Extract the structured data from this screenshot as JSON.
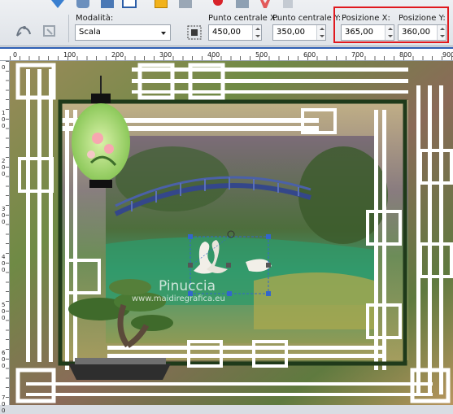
{
  "toolbar": {
    "mode_label": "Modalità:",
    "mode_value": "Scala",
    "center_x_label": "Punto centrale X:",
    "center_x_value": "450,00",
    "center_y_label": "Punto centrale Y:",
    "center_y_value": "350,00",
    "pos_x_label": "Posizione X:",
    "pos_x_value": "365,00",
    "pos_y_label": "Posizione Y:",
    "pos_y_value": "360,00"
  },
  "ruler": {
    "top_labels": [
      "0",
      "100",
      "200",
      "300",
      "400",
      "500",
      "600",
      "700",
      "800",
      "900"
    ],
    "left_labels": [
      "0",
      "1 0 0",
      "2 0 0",
      "3 0 0",
      "4 0 0",
      "5 0 0",
      "6 0 0",
      "7 0 0"
    ]
  },
  "canvas": {
    "watermark_name": "Pinuccia",
    "watermark_site": "www.maidiregrafica.eu"
  },
  "colors": {
    "highlight": "#e0191e",
    "ruler_accent": "#2f5fb3",
    "frame_dark": "#1f3a1a"
  }
}
